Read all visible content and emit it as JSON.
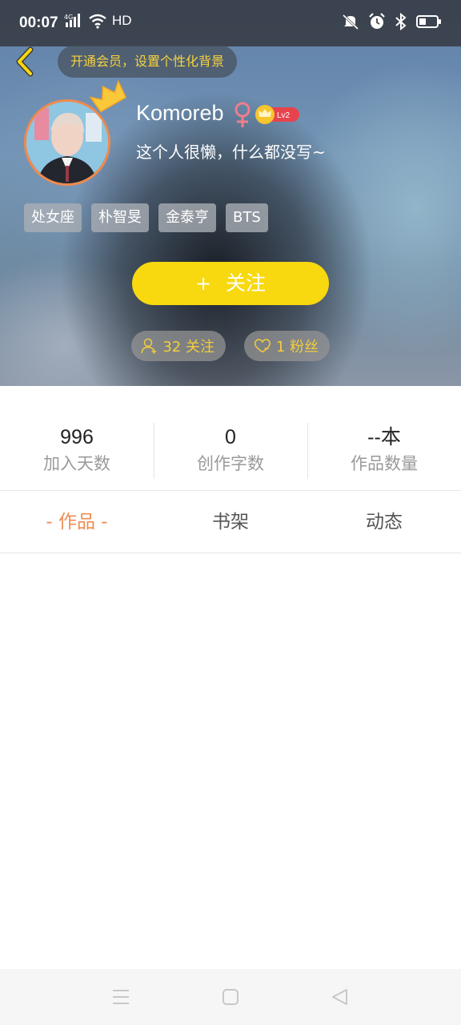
{
  "status_bar": {
    "time": "00:07",
    "network": "HD",
    "icons": [
      "4g-signal-icon",
      "wifi-icon",
      "mute-icon",
      "alarm-icon",
      "bluetooth-icon",
      "battery-icon"
    ]
  },
  "header": {
    "vip_banner": "开通会员，设置个性化背景",
    "nickname": "Komoreb",
    "gender_symbol": "♀",
    "level": "Lv2",
    "bio": "这个人很懒，什么都没写~",
    "tags": [
      "处女座",
      "朴智旻",
      "金泰亨",
      "BTS"
    ],
    "follow_button": {
      "plus": "+",
      "label": "关注"
    },
    "following": "32 关注",
    "fans": "1 粉丝"
  },
  "stats": [
    {
      "value": "996",
      "label": "加入天数"
    },
    {
      "value": "0",
      "label": "创作字数"
    },
    {
      "value": "--本",
      "label": "作品数量"
    }
  ],
  "tabs": [
    {
      "label": "- 作品 -",
      "active": true
    },
    {
      "label": "书架",
      "active": false
    },
    {
      "label": "动态",
      "active": false
    }
  ],
  "colors": {
    "accent_orange": "#ef8c52",
    "follow_yellow": "#f8d80f",
    "banner_text": "#f6d23c",
    "level_badge": "#e8434d"
  }
}
